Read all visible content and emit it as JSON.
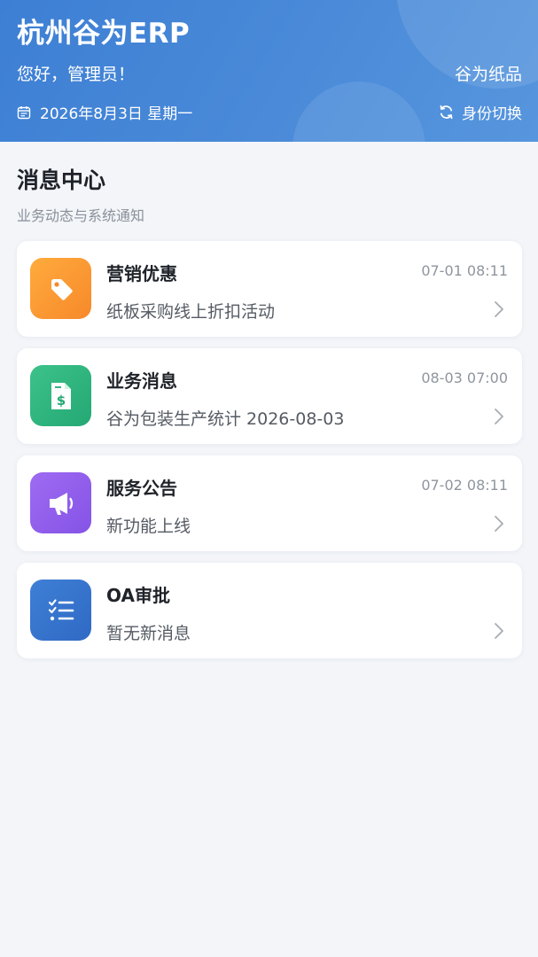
{
  "header": {
    "app_title": "杭州谷为ERP",
    "greeting": "您好，管理员！",
    "company": "谷为纸品",
    "date": "2026年8月3日 星期一",
    "switch_label": "身份切换",
    "colors": {
      "gradient_start": "#3d7fd4",
      "gradient_end": "#5796de"
    }
  },
  "section": {
    "title": "消息中心",
    "subtitle": "业务动态与系统通知"
  },
  "messages": [
    {
      "name": "营销优惠",
      "time": "07-01 08:11",
      "text": "纸板采购线上折扣活动",
      "icon": "tag-icon",
      "color": "#f7892a"
    },
    {
      "name": "业务消息",
      "time": "08-03 07:00",
      "text": "谷为包装生产统计 2026-08-03",
      "icon": "document-dollar-icon",
      "color": "#24a874"
    },
    {
      "name": "服务公告",
      "time": "07-02 08:11",
      "text": "新功能上线",
      "icon": "megaphone-icon",
      "color": "#8553e6"
    },
    {
      "name": "OA审批",
      "time": "",
      "text": "暂无新消息",
      "icon": "checklist-icon",
      "color": "#2f6ac4"
    }
  ]
}
